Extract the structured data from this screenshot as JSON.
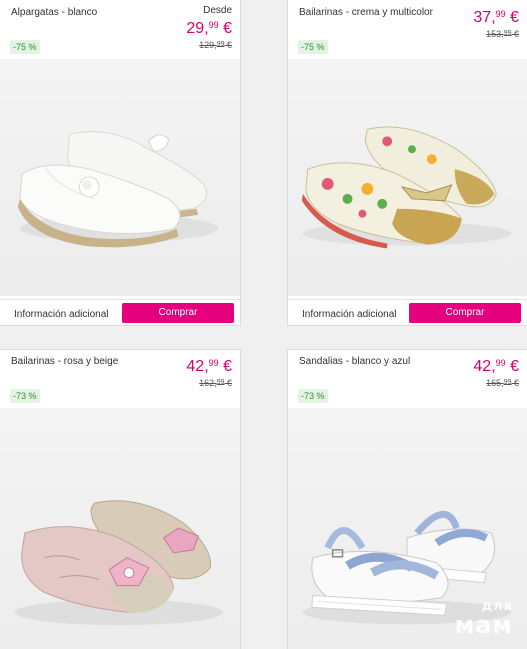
{
  "products": [
    {
      "title": "Alpargatas - blanco",
      "prefix": "Desde",
      "price_main": "29,",
      "price_cents": "99",
      "price_currency": " €",
      "old_main": "129,",
      "old_cents": "99",
      "old_currency": " €",
      "discount": "-75 %",
      "info_label": "Información adicional",
      "buy_label": "Comprar",
      "image_icon": "white-espadrille-shoes"
    },
    {
      "title": "Bailarinas - crema y multicolor",
      "prefix": "",
      "price_main": "37,",
      "price_cents": "99",
      "price_currency": " €",
      "old_main": "153,",
      "old_cents": "99",
      "old_currency": " €",
      "discount": "-75 %",
      "info_label": "Información adicional",
      "buy_label": "Comprar",
      "image_icon": "floral-glitter-ballet-flats"
    },
    {
      "title": "Bailarinas - rosa y beige",
      "prefix": "",
      "price_main": "42,",
      "price_cents": "99",
      "price_currency": " €",
      "old_main": "162,",
      "old_cents": "99",
      "old_currency": " €",
      "discount": "-73 %",
      "image_icon": "pink-beige-jeweled-flats"
    },
    {
      "title": "Sandalias - blanco y azul",
      "prefix": "",
      "price_main": "42,",
      "price_cents": "99",
      "price_currency": " €",
      "old_main": "165,",
      "old_cents": "99",
      "old_currency": " €",
      "discount": "-73 %",
      "image_icon": "white-blue-sandals"
    }
  ],
  "watermark": {
    "line1": "для",
    "line2": "мам"
  },
  "colors": {
    "price": "#d6006d",
    "buy_button": "#e5007d",
    "discount_bg": "#e2f3e2",
    "discount_text": "#3a8a3a"
  }
}
